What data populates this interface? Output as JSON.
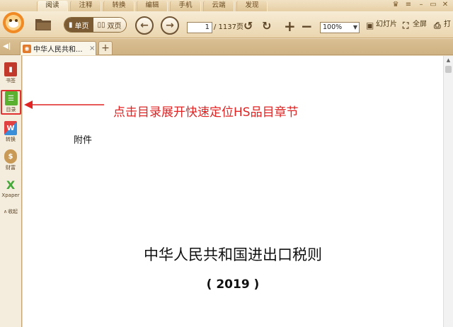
{
  "menu": {
    "tabs": [
      {
        "label": "阅读",
        "active": true
      },
      {
        "label": "注释",
        "active": false
      },
      {
        "label": "转换",
        "active": false
      },
      {
        "label": "编辑",
        "active": false
      },
      {
        "label": "手机",
        "active": false
      },
      {
        "label": "云端",
        "active": false
      },
      {
        "label": "发现",
        "active": false
      }
    ]
  },
  "toolbar": {
    "single_page_label": "单页",
    "double_page_label": "双页",
    "page_current": "1",
    "page_total": "/ 1137页",
    "zoom_value": "100%",
    "slideshow_label": "幻灯片",
    "fullscreen_label": "全屏",
    "print_label": "打"
  },
  "tabs": {
    "document_title": "中华人民共和...",
    "close_glyph": "×",
    "add_glyph": "+"
  },
  "sidebar": {
    "items": [
      {
        "label": "书签",
        "color": "#c0392b"
      },
      {
        "label": "目录",
        "color": "#5bb030"
      },
      {
        "label": "转换",
        "color": "#3b8fd9"
      },
      {
        "label": "财富",
        "color": "#c89a55"
      },
      {
        "label": "Xpaper",
        "color": "#44a83a"
      }
    ],
    "collapse_label": "收起"
  },
  "document": {
    "annotation": "点击目录展开快速定位HS品目章节",
    "attachment_label": "附件",
    "heading": "中华人民共和国进出口税则",
    "year": "( 2019 )"
  },
  "colors": {
    "annotation_red": "#e02424",
    "toolbar_brown": "#7a5b33"
  }
}
